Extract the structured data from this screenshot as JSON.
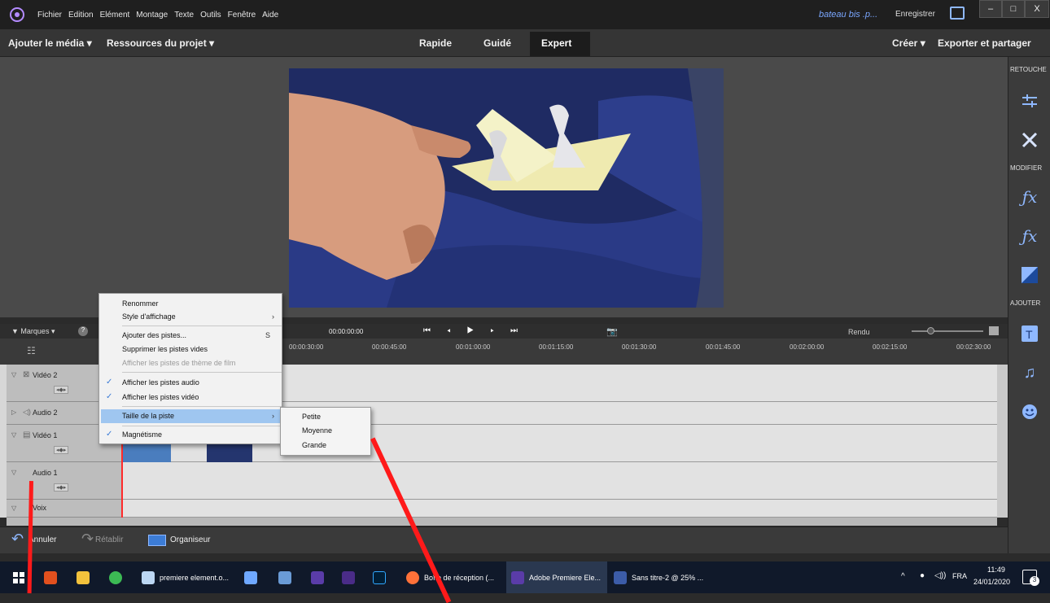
{
  "menubar": {
    "items": [
      "Fichier",
      "Edition",
      "Elément",
      "Montage",
      "Texte",
      "Outils",
      "Fenêtre",
      "Aide"
    ],
    "document_name": "bateau bis .p...",
    "save_label": "Enregistrer",
    "window_buttons": [
      "–",
      "□",
      "X"
    ]
  },
  "toolbar": {
    "add_media": "Ajouter le média ▾",
    "project_assets": "Ressources du projet ▾",
    "modes": [
      "Rapide",
      "Guidé",
      "Expert"
    ],
    "active_mode": "Expert",
    "create": "Créer ▾",
    "export_share": "Exporter et partager"
  },
  "right_panel": {
    "sections": [
      "RETOUCHE",
      "MODIFIER",
      "AJOUTER"
    ],
    "icons": [
      "adjust-sliders-icon",
      "tools-icon",
      "applied-effects-icon",
      "effects-icon",
      "transitions-icon",
      "titles-icon",
      "music-icon",
      "graphics-icon"
    ]
  },
  "timeline": {
    "markers_label": "Marques",
    "timecode": "00:00:00:00",
    "render_label": "Rendu",
    "ruler": [
      "00:00:30:00",
      "00:00:45:00",
      "00:01:00:00",
      "00:01:15:00",
      "00:01:30:00",
      "00:01:45:00",
      "00:02:00:00",
      "00:02:15:00",
      "00:02:30:00"
    ],
    "tracks": [
      {
        "name": "Vidéo 2"
      },
      {
        "name": "Audio 2"
      },
      {
        "name": "Vidéo 1"
      },
      {
        "name": "Audio 1"
      },
      {
        "name": "Voix"
      }
    ]
  },
  "context_menu": {
    "items": [
      {
        "label": "Renommer",
        "checked": false,
        "disabled": false,
        "arrow": false,
        "shortcut": ""
      },
      {
        "label": "Style d'affichage",
        "checked": false,
        "disabled": false,
        "arrow": true,
        "shortcut": ""
      },
      {
        "label": "Ajouter des pistes...",
        "checked": false,
        "disabled": false,
        "arrow": false,
        "shortcut": "S"
      },
      {
        "label": "Supprimer les pistes vides",
        "checked": false,
        "disabled": false,
        "arrow": false,
        "shortcut": ""
      },
      {
        "label": "Afficher les pistes de thème de film",
        "checked": false,
        "disabled": true,
        "arrow": false,
        "shortcut": ""
      },
      {
        "label": "Afficher les pistes audio",
        "checked": true,
        "disabled": false,
        "arrow": false,
        "shortcut": ""
      },
      {
        "label": "Afficher les pistes vidéo",
        "checked": true,
        "disabled": false,
        "arrow": false,
        "shortcut": ""
      },
      {
        "label": "Taille de la piste",
        "checked": false,
        "disabled": false,
        "arrow": true,
        "shortcut": "",
        "highlighted": true
      },
      {
        "label": "Magnétisme",
        "checked": true,
        "disabled": false,
        "arrow": false,
        "shortcut": ""
      }
    ],
    "submenu": [
      "Petite",
      "Moyenne",
      "Grande"
    ]
  },
  "bottom_bar": {
    "undo": "Annuler",
    "redo": "Rétablir",
    "organizer": "Organiseur"
  },
  "taskbar": {
    "apps": [
      "premiere element.o...",
      "Boîte de réception (...",
      "Adobe Premiere Ele...",
      "Sans titre-2 @ 25% ..."
    ],
    "language": "FRA",
    "time": "11:49",
    "date": "24/01/2020",
    "notification_count": "3"
  },
  "colors": {
    "accent": "#3c7cd6",
    "annotation": "#ff1a1a"
  }
}
